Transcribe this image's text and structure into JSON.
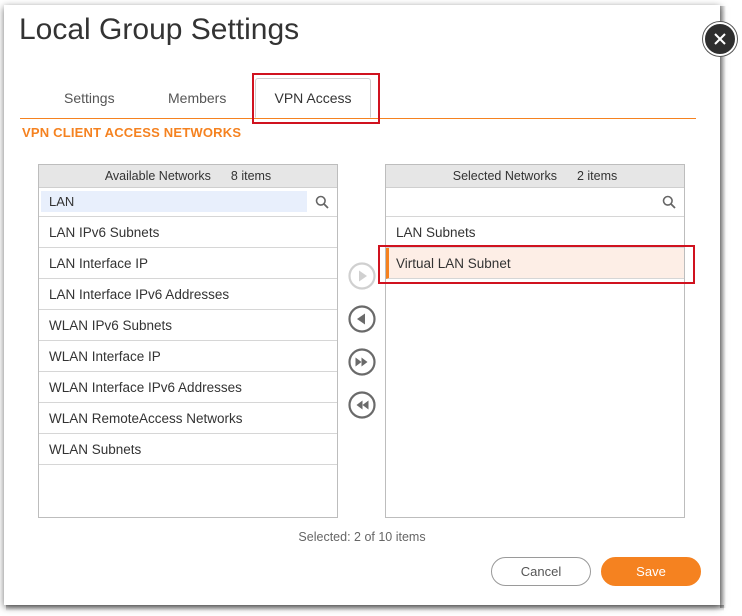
{
  "dialog": {
    "title": "Local Group Settings"
  },
  "tabs": [
    {
      "label": "Settings"
    },
    {
      "label": "Members"
    },
    {
      "label": "VPN Access"
    }
  ],
  "active_tab": "VPN Access",
  "section_title": "VPN CLIENT ACCESS NETWORKS",
  "available": {
    "header": "Available Networks",
    "count": "8 items",
    "filter_value": "LAN",
    "items": [
      {
        "label": "LAN IPv6 Subnets"
      },
      {
        "label": "LAN Interface IP"
      },
      {
        "label": "LAN Interface IPv6 Addresses"
      },
      {
        "label": "WLAN IPv6 Subnets"
      },
      {
        "label": "WLAN Interface IP"
      },
      {
        "label": "WLAN Interface IPv6 Addresses"
      },
      {
        "label": "WLAN RemoteAccess Networks"
      },
      {
        "label": "WLAN Subnets"
      }
    ]
  },
  "selected": {
    "header": "Selected Networks",
    "count": "2 items",
    "filter_value": "",
    "items": [
      {
        "label": "LAN Subnets"
      },
      {
        "label": "Virtual LAN Subnet"
      }
    ]
  },
  "status": "Selected: 2 of 10 items",
  "buttons": {
    "cancel": "Cancel",
    "save": "Save"
  },
  "colors": {
    "accent": "#f58220",
    "highlight": "#d0121f"
  }
}
